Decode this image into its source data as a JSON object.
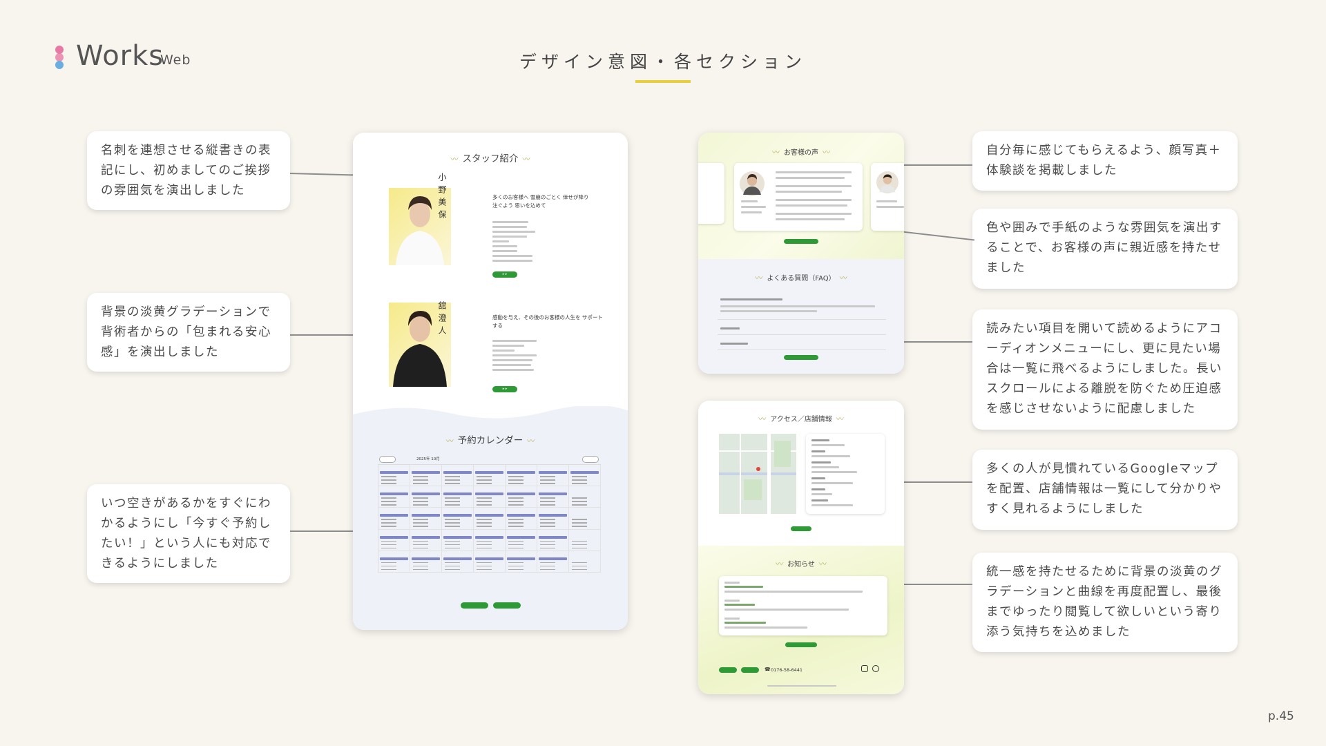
{
  "header": {
    "brand": "Works",
    "brand_sub": "Web",
    "title": "デザイン意図・各セクション",
    "page_number": "p.45"
  },
  "colors": {
    "accent_yellow": "#e6cf3c",
    "button_green": "#2e9a36",
    "calendar_bar": "#7f87c9",
    "logo_pink": "#e77aa4",
    "logo_blue": "#6aaee0"
  },
  "callouts": [
    "名刺を連想させる縦書きの表記にし、初めましてのご挨拶の雰囲気を演出しました",
    "背景の淡黄グラデーションで背術者からの「包まれる安心感」を演出しました",
    "いつ空きがあるかをすぐにわかるようにし「今すぐ予約したい！」という人にも対応できるようにしました",
    "自分毎に感じてもらえるよう、顔写真＋体験談を掲載しました",
    "色や囲みで手紙のような雰囲気を演出することで、お客様の声に親近感を持たせました",
    "読みたい項目を開いて読めるようにアコーディオンメニューにし、更に見たい場合は一覧に飛べるようにしました。長いスクロールによる離脱を防ぐため圧迫感を感じさせないように配慮しました",
    "多くの人が見慣れているGoogleマップを配置、店舗情報は一覧にして分かりやすく見れるようにしました",
    "統一感を持たせるために背景の淡黄のグラデーションと曲線を再度配置し、最後までゆったり閲覧して欲しいという寄り添う気持ちを込めました"
  ],
  "mock_left": {
    "staff_title": "スタッフ紹介",
    "staff1_name": "小野美保",
    "staff1_catch": "多くのお客様へ 雪崩のごとく 倖せが降り注ぐよう 思いを込めて",
    "staff2_name": "舘澄人",
    "staff2_catch": "感動を与え、その後のお客様の人生を サポートする",
    "calendar_title": "予約カレンダー",
    "calendar_month": "2025年 10月"
  },
  "mock_right_top": {
    "voice_title": "お客様の声",
    "faq_title": "よくある質問（FAQ）"
  },
  "mock_right_bottom": {
    "access_title": "アクセス／店舗情報",
    "news_title": "お知らせ",
    "phone": "0176-58-6441"
  }
}
